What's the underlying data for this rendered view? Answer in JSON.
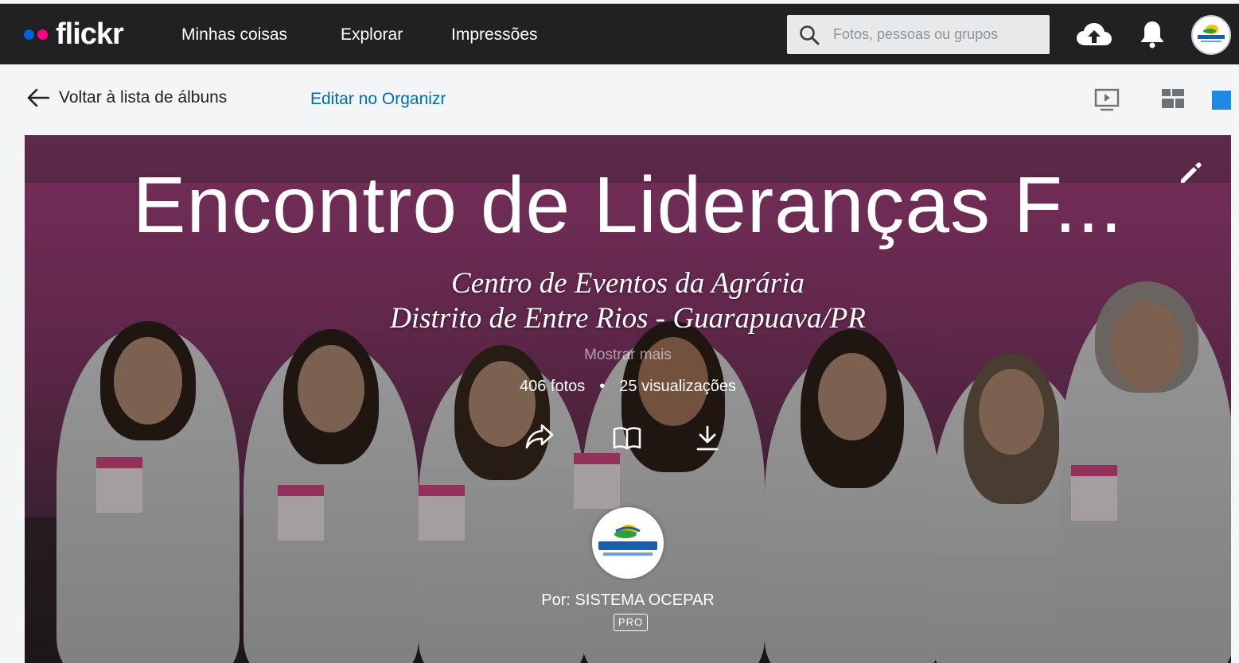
{
  "nav": {
    "logo": "flickr",
    "links": [
      "Minhas coisas",
      "Explorar",
      "Impressões"
    ],
    "search_placeholder": "Fotos, pessoas ou grupos"
  },
  "subbar": {
    "back_label": "Voltar à lista de álbuns",
    "edit_label": "Editar no Organizr"
  },
  "album": {
    "title": "Encontro de Lideranças F...",
    "description_line1": "Centro de Eventos da Agrária",
    "description_line2": "Distrito de Entre Rios - Guarapuava/PR",
    "show_more": "Mostrar mais",
    "photos_count": "406 fotos",
    "views_count": "25 visualizações",
    "owner": "Por: SISTEMA OCEPAR",
    "pro_badge": "PRO"
  },
  "colors": {
    "nav_bg": "#212124",
    "link_blue": "#006dac",
    "logo_blue": "#0063dc",
    "logo_pink": "#ff0084",
    "accent_square": "#1e88e5"
  },
  "icons": {
    "search": "search-icon",
    "upload": "cloud-upload-icon",
    "notifications": "bell-icon",
    "back": "arrow-left-icon",
    "slideshow": "slideshow-icon",
    "grid": "grid-layout-icon",
    "share": "share-icon",
    "book": "book-icon",
    "download": "download-icon",
    "edit": "pencil-icon"
  }
}
